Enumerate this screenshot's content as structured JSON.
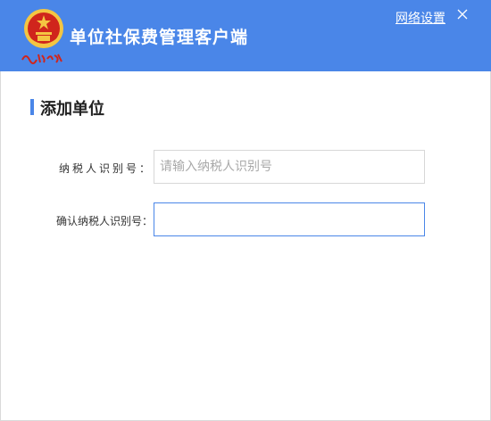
{
  "app": {
    "title": "单位社保费管理客户端",
    "network_settings": "网络设置",
    "brand_script": "中国税务"
  },
  "colors": {
    "header_bg": "#4a86e8",
    "accent": "#4a86e8",
    "emblem_red": "#d0251c",
    "emblem_gold": "#f4c542"
  },
  "icons": {
    "close": "close-icon",
    "emblem": "tax-emblem-icon"
  },
  "section": {
    "title": "添加单位"
  },
  "form": {
    "taxpayer_id_label": "纳税人识别号：",
    "taxpayer_id_placeholder": "请输入纳税人识别号",
    "taxpayer_id_value": "",
    "confirm_id_label": "确认纳税人识别号：",
    "confirm_id_value": ""
  }
}
